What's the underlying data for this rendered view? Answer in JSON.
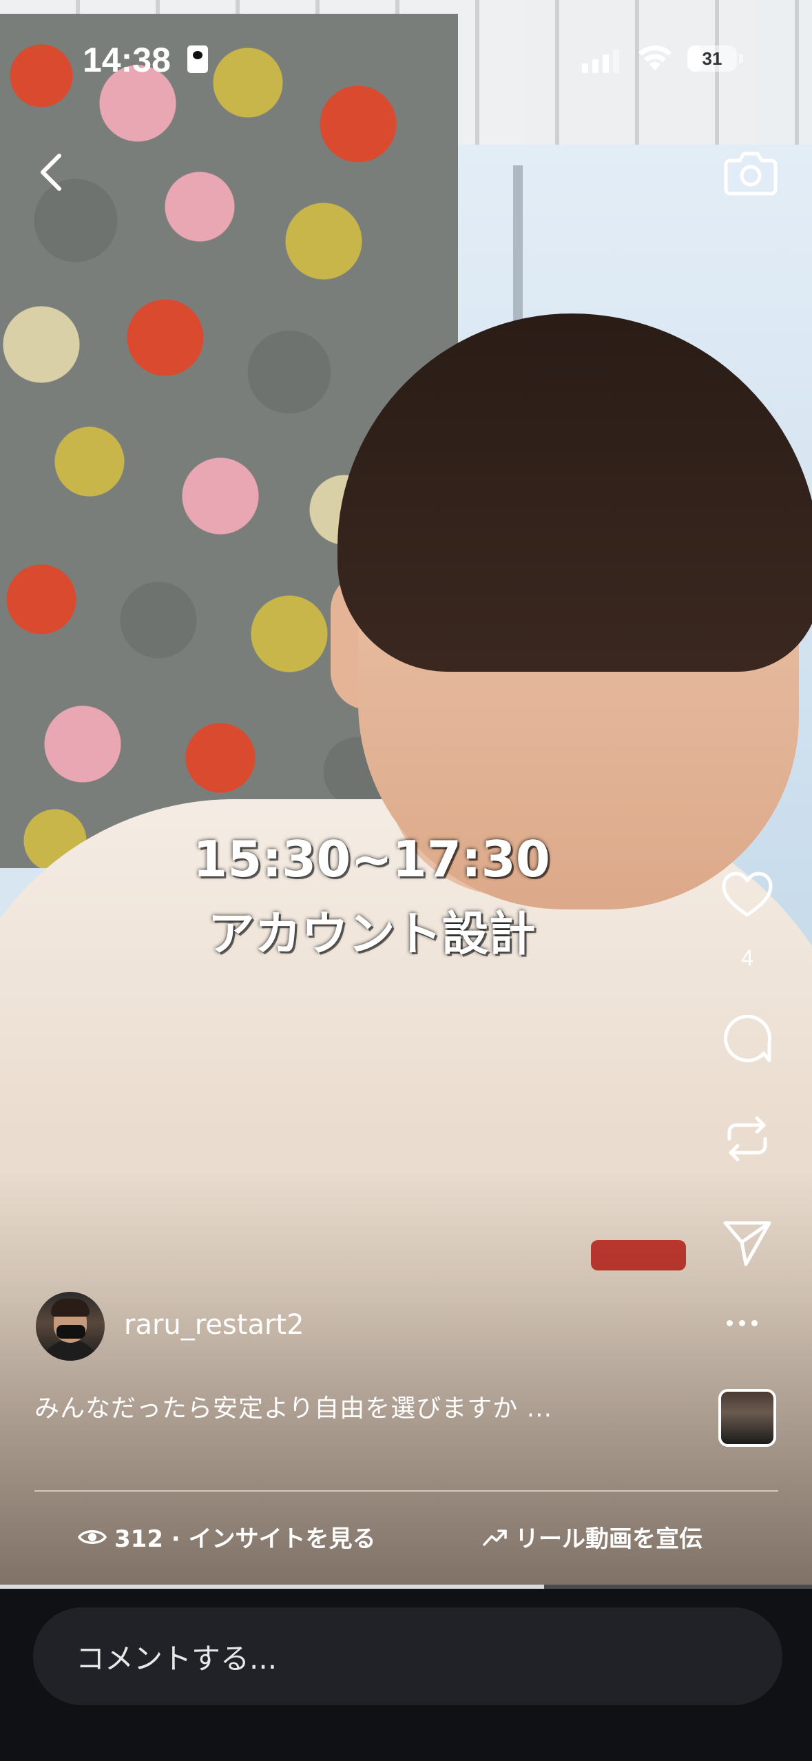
{
  "status_bar": {
    "time": "14:38",
    "battery": "31",
    "battery_level": 0.31
  },
  "top_nav": {
    "back_icon": "chevron-left-icon",
    "camera_icon": "camera-icon"
  },
  "video": {
    "overlay_line1": "15:30~17:30",
    "overlay_line2": "アカウント設計",
    "progress": 0.67
  },
  "actions": {
    "like_icon": "heart-icon",
    "like_count": "4",
    "comment_icon": "comment-bubble-icon",
    "repost_icon": "repost-icon",
    "share_icon": "paper-plane-icon",
    "more_icon": "more-horizontal-icon"
  },
  "author": {
    "username": "raru_restart2"
  },
  "post": {
    "caption": "みんなだったら安定より自由を選びますか ..."
  },
  "footer": {
    "insights_text": "312 · インサイトを見る",
    "promote_text": "リール動画を宣伝"
  },
  "comment": {
    "placeholder": "コメントする..."
  }
}
